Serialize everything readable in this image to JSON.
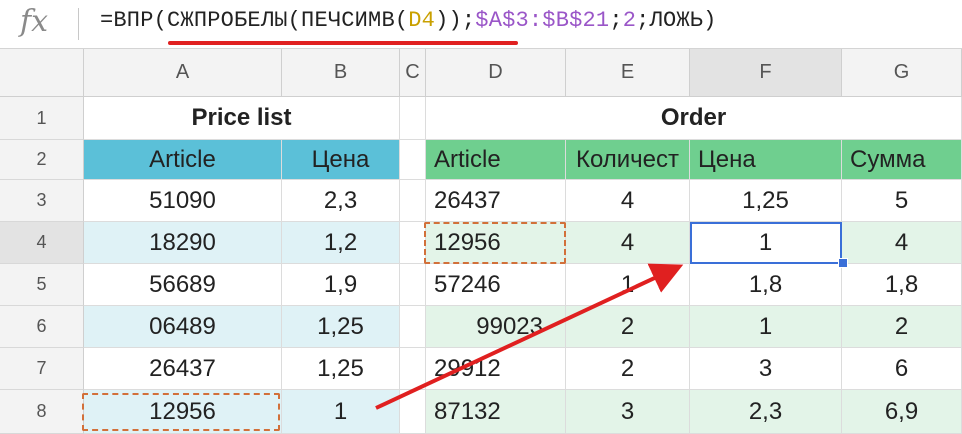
{
  "formula_bar": {
    "icon": "fx-icon",
    "parts": [
      {
        "text": "=ВПР(",
        "color": "#222222"
      },
      {
        "text": "СЖПРОБЕЛЫ(ПЕЧСИМВ(",
        "color": "#222222"
      },
      {
        "text": "D4",
        "color": "#c9a000"
      },
      {
        "text": "))",
        "color": "#222222"
      },
      {
        "text": ";",
        "color": "#222222"
      },
      {
        "text": "$A$3:$B$21",
        "color": "#9a56c8"
      },
      {
        "text": ";",
        "color": "#222222"
      },
      {
        "text": "2",
        "color": "#9a56c8"
      },
      {
        "text": ";ЛОЖЬ)",
        "color": "#222222"
      }
    ]
  },
  "columns": [
    "A",
    "B",
    "C",
    "D",
    "E",
    "F",
    "G"
  ],
  "rows": [
    "1",
    "2",
    "3",
    "4",
    "5",
    "6",
    "7",
    "8"
  ],
  "price_list": {
    "title": "Price list",
    "header": [
      "Article",
      "Цена"
    ],
    "rows": [
      [
        "51090",
        "2,3"
      ],
      [
        "18290",
        "1,2"
      ],
      [
        "56689",
        "1,9"
      ],
      [
        "06489",
        "1,25"
      ],
      [
        "26437",
        "1,25"
      ],
      [
        "12956",
        "1"
      ]
    ]
  },
  "order": {
    "title": "Order",
    "header": [
      "Article",
      "Количест",
      "Цена",
      "Сумма"
    ],
    "rows": [
      [
        "26437",
        "4",
        "1,25",
        "5"
      ],
      [
        "12956",
        "4",
        "1",
        "4"
      ],
      [
        "57246",
        "1",
        "1,8",
        "1,8"
      ],
      [
        "99023",
        "2",
        "1",
        "2"
      ],
      [
        "29912",
        "2",
        "3",
        "6"
      ],
      [
        "87132",
        "3",
        "2,3",
        "6,9"
      ]
    ]
  },
  "colors": {
    "price_header_bg": "#5bc0d8",
    "order_header_bg": "#6fcf8f",
    "price_stripe": "#dff2f6",
    "order_stripe": "#e3f4e8",
    "highlight_outline": "#3a6fd8",
    "annotation": "#e02020"
  }
}
